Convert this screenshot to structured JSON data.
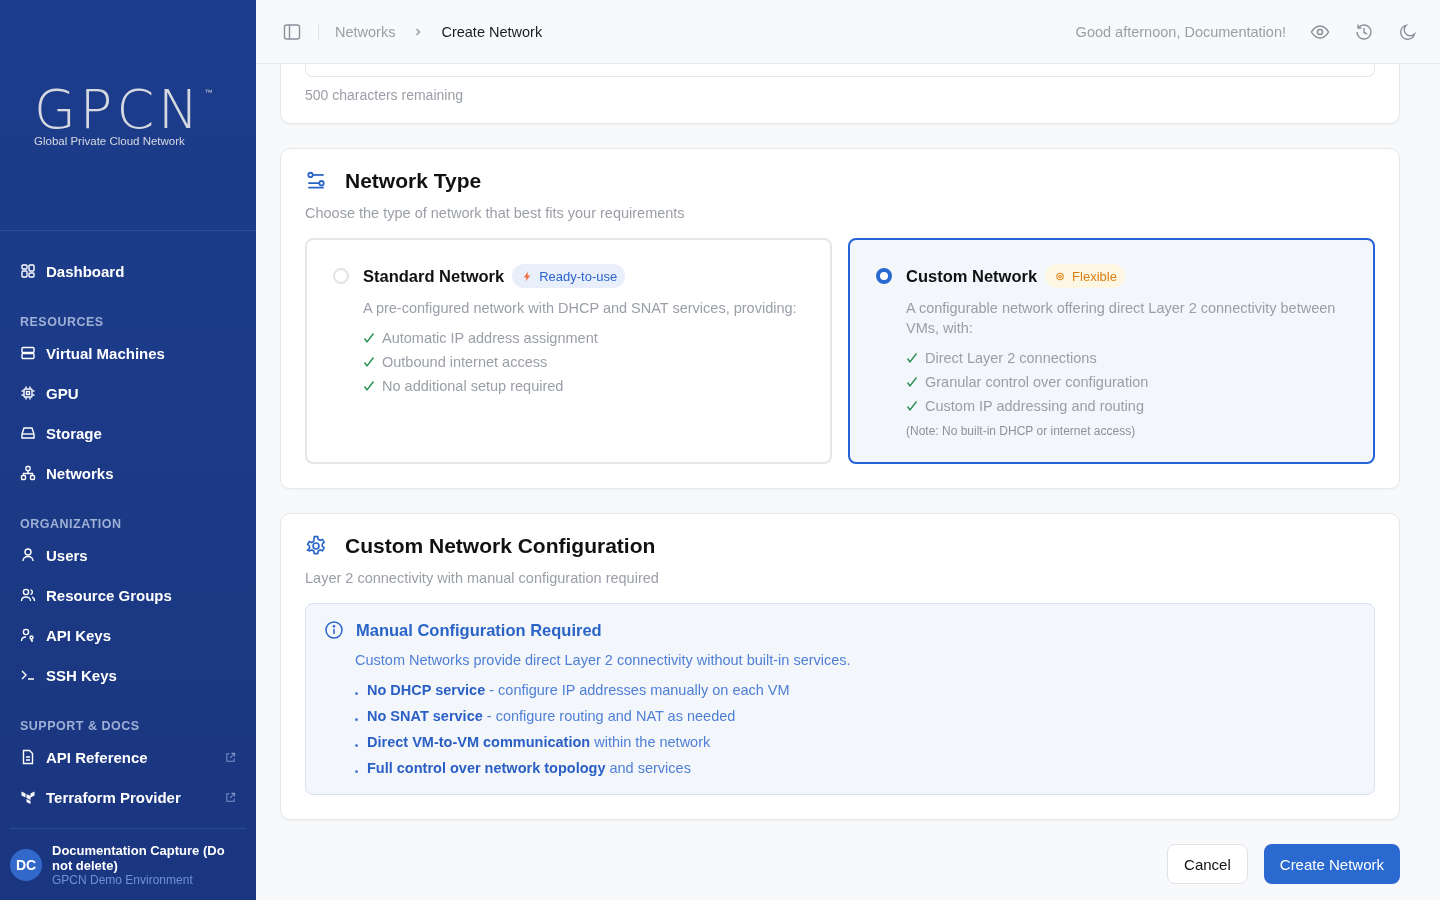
{
  "sidebar": {
    "logo": "GPCN",
    "trademark": "™",
    "tagline": "Global Private Cloud Network",
    "top_items": [
      {
        "label": "Dashboard",
        "external": false
      }
    ],
    "sections": [
      {
        "title": "RESOURCES",
        "items": [
          {
            "label": "Virtual Machines",
            "external": false
          },
          {
            "label": "GPU",
            "external": false
          },
          {
            "label": "Storage",
            "external": false
          },
          {
            "label": "Networks",
            "external": false
          }
        ]
      },
      {
        "title": "ORGANIZATION",
        "items": [
          {
            "label": "Users",
            "external": false
          },
          {
            "label": "Resource Groups",
            "external": false
          },
          {
            "label": "API Keys",
            "external": false
          },
          {
            "label": "SSH Keys",
            "external": false
          }
        ]
      },
      {
        "title": "SUPPORT & DOCS",
        "items": [
          {
            "label": "API Reference",
            "external": true
          },
          {
            "label": "Terraform Provider",
            "external": true
          }
        ]
      }
    ],
    "user": {
      "initials": "DC",
      "name": "Documentation Capture (Do not delete)",
      "org": "GPCN Demo Environment"
    }
  },
  "header": {
    "breadcrumbs": [
      "Networks",
      "Create Network"
    ],
    "greeting": "Good afternoon, Documentation!"
  },
  "description_field": {
    "counter": "500 characters remaining"
  },
  "network_type": {
    "title": "Network Type",
    "subtitle": "Choose the type of network that best fits your requirements",
    "options": [
      {
        "name": "Standard Network",
        "badge": "Ready-to-use",
        "kind": "ready",
        "selected": false,
        "description": "A pre-configured network with DHCP and SNAT services, providing:",
        "features": [
          "Automatic IP address assignment",
          "Outbound internet access",
          "No additional setup required"
        ]
      },
      {
        "name": "Custom Network",
        "badge": "Flexible",
        "kind": "flexible",
        "selected": true,
        "description": "A configurable network offering direct Layer 2 connectivity between VMs, with:",
        "features": [
          "Direct Layer 2 connections",
          "Granular control over configuration",
          "Custom IP addressing and routing"
        ],
        "note": "(Note: No built-in DHCP or internet access)"
      }
    ]
  },
  "configuration": {
    "title": "Custom Network Configuration",
    "subtitle": "Layer 2 connectivity with manual configuration required",
    "notice": {
      "title": "Manual Configuration Required",
      "text": "Custom Networks provide direct Layer 2 connectivity without built-in services.",
      "points": [
        "**No DHCP service** - configure IP addresses manually on each VM",
        "**No SNAT service** - configure routing and NAT as needed",
        "**Direct VM-to-VM communication** within the network",
        "**Full control over network topology** and services"
      ]
    }
  },
  "actions": {
    "cancel": "Cancel",
    "submit": "Create Network"
  }
}
